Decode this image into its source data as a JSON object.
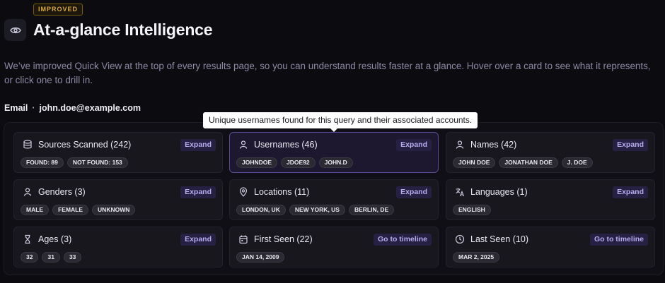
{
  "header": {
    "badge": "IMPROVED",
    "title": "At-a-glance Intelligence",
    "intro": "We’ve improved Quick View at the top of every results page, so you can understand results faster at a glance. Hover over a card to see what it represents, or click one to drill in."
  },
  "query": {
    "type": "Email",
    "separator": "·",
    "value": "john.doe@example.com"
  },
  "tooltip": "Unique usernames found for this query and their associated accounts.",
  "cards": [
    {
      "title": "Sources Scanned (242)",
      "action": "Expand",
      "icon": "database-icon",
      "chips": [
        "FOUND: 89",
        "NOT FOUND: 153"
      ]
    },
    {
      "title": "Usernames (46)",
      "action": "Expand",
      "icon": "user-icon",
      "chips": [
        "JOHNDOE",
        "JDOE92",
        "JOHN.D"
      ]
    },
    {
      "title": "Names (42)",
      "action": "Expand",
      "icon": "user-icon",
      "chips": [
        "JOHN DOE",
        "JONATHAN DOE",
        "J. DOE"
      ]
    },
    {
      "title": "Genders (3)",
      "action": "Expand",
      "icon": "user-icon",
      "chips": [
        "MALE",
        "FEMALE",
        "UNKNOWN"
      ]
    },
    {
      "title": "Locations (11)",
      "action": "Expand",
      "icon": "location-pin-icon",
      "chips": [
        "LONDON, UK",
        "NEW YORK, US",
        "BERLIN, DE"
      ]
    },
    {
      "title": "Languages (1)",
      "action": "Expand",
      "icon": "translate-icon",
      "chips": [
        "ENGLISH"
      ]
    },
    {
      "title": "Ages (3)",
      "action": "Expand",
      "icon": "hourglass-icon",
      "chips": [
        "32",
        "31",
        "33"
      ]
    },
    {
      "title": "First Seen (22)",
      "action": "Go to timeline",
      "icon": "calendar-icon",
      "chips": [
        "JAN 14, 2009"
      ]
    },
    {
      "title": "Last Seen (10)",
      "action": "Go to timeline",
      "icon": "clock-icon",
      "chips": [
        "MAR 2, 2025"
      ]
    }
  ]
}
